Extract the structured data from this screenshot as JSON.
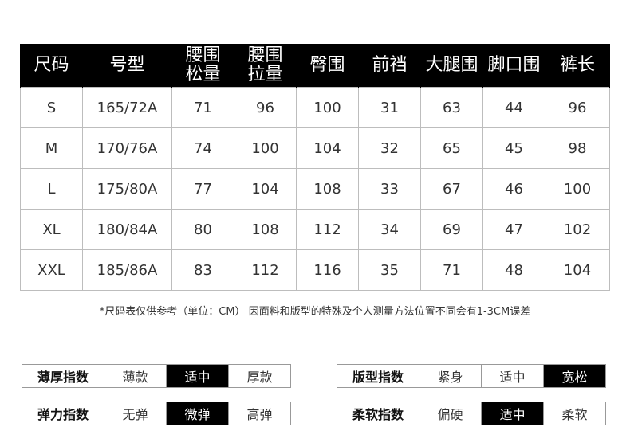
{
  "table": {
    "headers": [
      "尺码",
      "号型",
      "腰围\n松量",
      "腰围\n拉量",
      "臀围",
      "前裆",
      "大腿围",
      "脚口围",
      "裤长"
    ],
    "rows": [
      [
        "S",
        "165/72A",
        "71",
        "96",
        "100",
        "31",
        "63",
        "44",
        "96"
      ],
      [
        "M",
        "170/76A",
        "74",
        "100",
        "104",
        "32",
        "65",
        "45",
        "98"
      ],
      [
        "L",
        "175/80A",
        "77",
        "104",
        "108",
        "33",
        "67",
        "46",
        "100"
      ],
      [
        "XL",
        "180/84A",
        "80",
        "108",
        "112",
        "34",
        "69",
        "47",
        "102"
      ],
      [
        "XXL",
        "185/86A",
        "83",
        "112",
        "116",
        "35",
        "71",
        "48",
        "104"
      ]
    ]
  },
  "note": "*尺码表仅供参考（单位：CM）  因面料和版型的特殊及个人测量方法位置不同会有1-3CM误差",
  "ratings": [
    {
      "label": "薄厚指数",
      "options": [
        "薄款",
        "适中",
        "厚款"
      ],
      "selected_index": 1
    },
    {
      "label": "版型指数",
      "options": [
        "紧身",
        "适中",
        "宽松"
      ],
      "selected_index": 2
    },
    {
      "label": "弹力指数",
      "options": [
        "无弹",
        "微弹",
        "高弹"
      ],
      "selected_index": 1
    },
    {
      "label": "柔软指数",
      "options": [
        "偏硬",
        "适中",
        "柔软"
      ],
      "selected_index": 1
    }
  ],
  "colors": {
    "header_bg": "#000000",
    "selected_bg": "#000000",
    "border": "#bdbdbd"
  }
}
